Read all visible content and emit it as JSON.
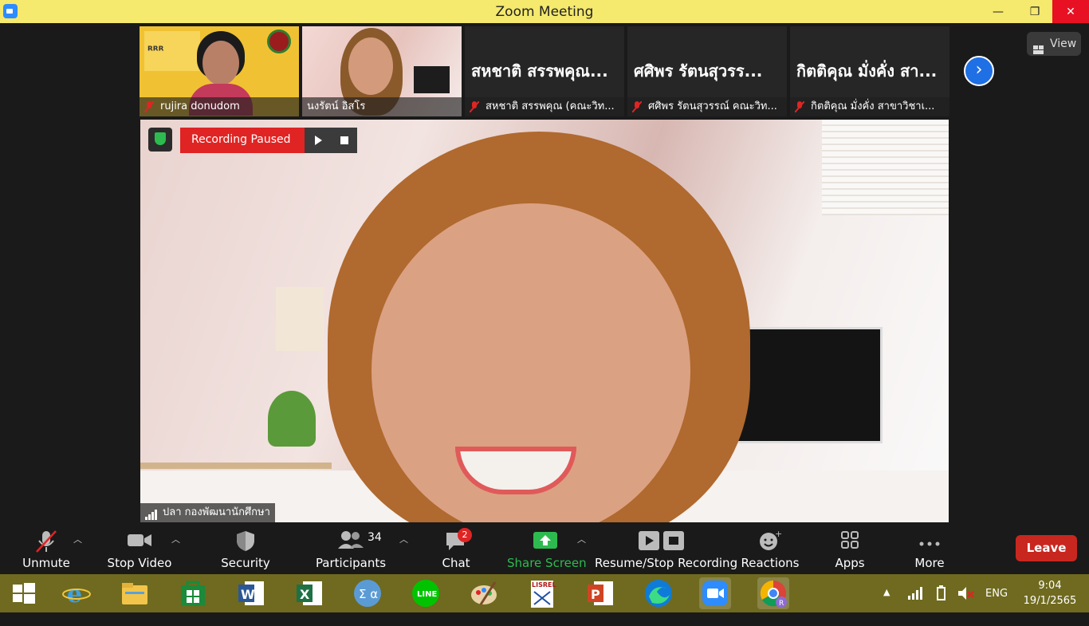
{
  "window": {
    "title": "Zoom Meeting",
    "min": "—",
    "max": "❐",
    "close": "✕"
  },
  "view_button": {
    "label": "View"
  },
  "next_page": "›",
  "thumbnails": [
    {
      "name": "rujira donudom",
      "muted": true,
      "video": true
    },
    {
      "name": "นงรัตน์ อิสโร",
      "muted": false,
      "video": true
    },
    {
      "big_name": "สหชาติ สรรพคุณ...",
      "name": "สหชาติ สรรพคุณ (คณะวิท...",
      "muted": true,
      "video": false
    },
    {
      "big_name": "ศศิพร รัตนสุวรร...",
      "name": "ศศิพร รัตนสุวรรณ์ คณะวิท...",
      "muted": true,
      "video": false
    },
    {
      "big_name": "กิตติคุณ มั่งคั่ง สา...",
      "name": "กิตติคุณ มั่งคั่ง สาขาวิชาเ...",
      "muted": true,
      "video": false
    }
  ],
  "recording": {
    "status": "Recording Paused"
  },
  "active_speaker": {
    "name": "ปลา กองพัฒนานักศึกษา"
  },
  "toolbar": {
    "unmute": "Unmute",
    "stop_video": "Stop Video",
    "security": "Security",
    "participants": "Participants",
    "participants_count": "34",
    "chat": "Chat",
    "chat_badge": "2",
    "share_screen": "Share Screen",
    "resume_stop_recording": "Resume/Stop Recording",
    "reactions": "Reactions",
    "apps": "Apps",
    "more": "More",
    "leave": "Leave"
  },
  "taskbar": {
    "apps": [
      "start-icon",
      "internet-explorer-icon",
      "file-explorer-icon",
      "microsoft-store-icon",
      "word-icon",
      "excel-icon",
      "math-input-icon",
      "line-icon",
      "paint-icon",
      "lisrel-icon",
      "powerpoint-icon",
      "edge-icon",
      "zoom-icon",
      "chrome-icon"
    ],
    "language": "ENG",
    "time": "9:04",
    "date": "19/1/2565"
  },
  "colors": {
    "titlebar": "#f5e96e",
    "taskbar": "#6f6a1f",
    "share_green": "#2dbb4f",
    "leave_red": "#c8271f",
    "recording_red": "#e02424"
  }
}
